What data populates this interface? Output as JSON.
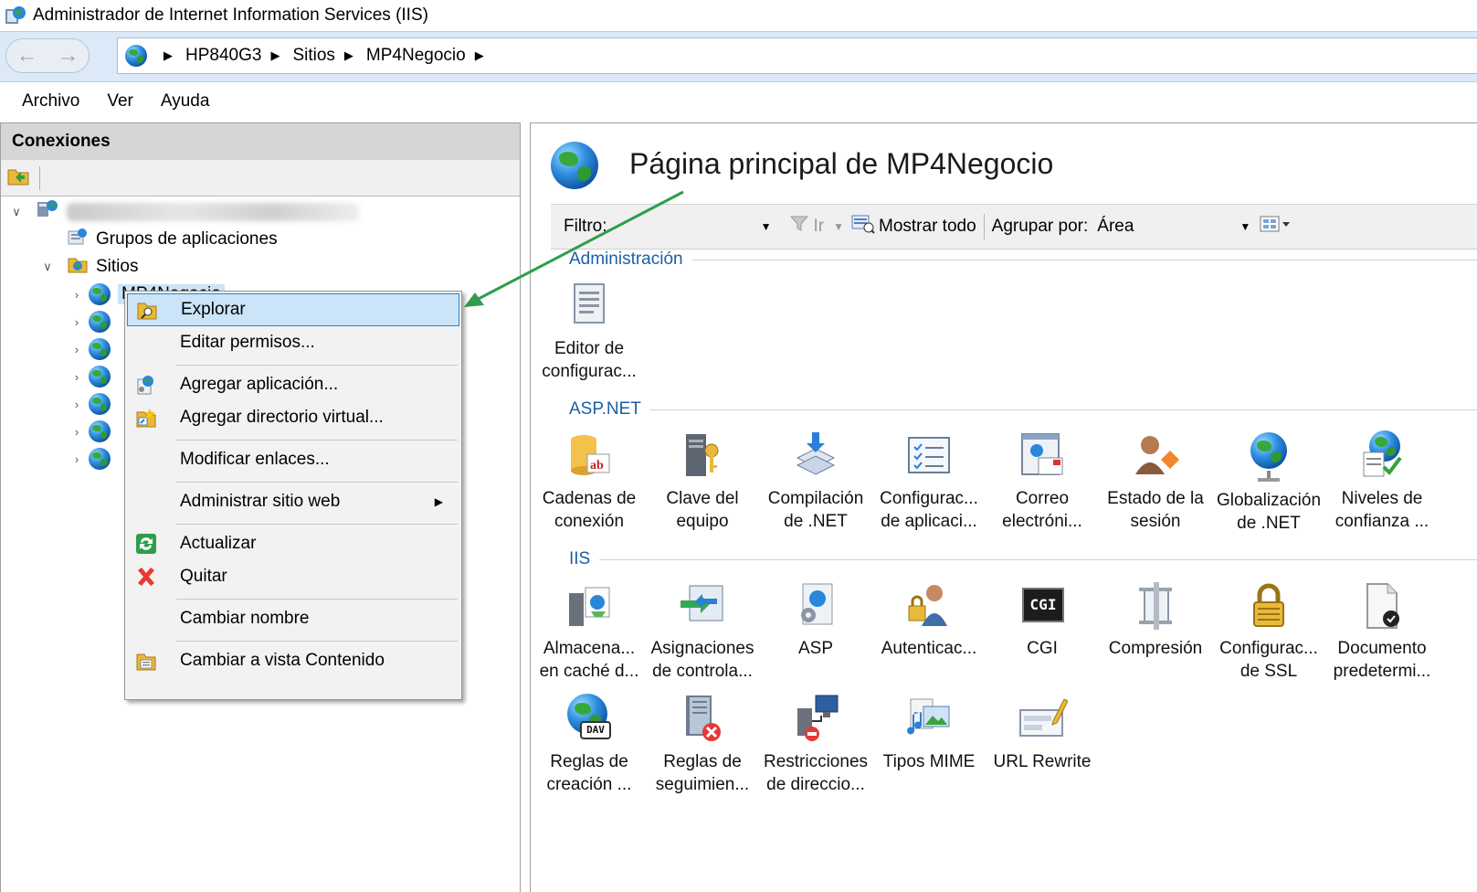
{
  "window": {
    "title": "Administrador de Internet Information Services (IIS)"
  },
  "address": {
    "crumbs": [
      "HP840G3",
      "Sitios",
      "MP4Negocio"
    ]
  },
  "menu": [
    "Archivo",
    "Ver",
    "Ayuda"
  ],
  "connections": {
    "header": "Conexiones",
    "tree": {
      "app_pools": "Grupos de aplicaciones",
      "sites": "Sitios",
      "selected_site": "MP4Negocio"
    }
  },
  "context_menu": {
    "items": [
      "Explorar",
      "Editar permisos...",
      "Agregar aplicación...",
      "Agregar directorio virtual...",
      "Modificar enlaces...",
      "Administrar sitio web",
      "Actualizar",
      "Quitar",
      "Cambiar nombre",
      "Cambiar a vista Contenido"
    ]
  },
  "main": {
    "title": "Página principal de MP4Negocio",
    "filter": {
      "label": "Filtro:",
      "go": "Ir",
      "show_all": "Mostrar todo",
      "group_by_label": "Agrupar por:",
      "group_by_value": "Área"
    },
    "sections": {
      "admin": "Administración",
      "aspnet": "ASP.NET",
      "iis": "IIS"
    },
    "admin_features": [
      {
        "l1": "Editor de",
        "l2": "configurac...",
        "icon": "config-editor-icon"
      }
    ],
    "aspnet_features": [
      {
        "l1": "Cadenas de",
        "l2": "conexión",
        "icon": "connection-strings-icon"
      },
      {
        "l1": "Clave del",
        "l2": "equipo",
        "icon": "machine-key-icon"
      },
      {
        "l1": "Compilación",
        "l2": "de .NET",
        "icon": "net-compilation-icon"
      },
      {
        "l1": "Configurac...",
        "l2": "de aplicaci...",
        "icon": "app-settings-icon"
      },
      {
        "l1": "Correo",
        "l2": "electróni...",
        "icon": "smtp-email-icon"
      },
      {
        "l1": "Estado de la",
        "l2": "sesión",
        "icon": "session-state-icon"
      },
      {
        "l1": "Globalización",
        "l2": "de .NET",
        "icon": "net-globalization-icon"
      },
      {
        "l1": "Niveles de",
        "l2": "confianza ...",
        "icon": "trust-levels-icon"
      }
    ],
    "iis_features": [
      {
        "l1": "Almacena...",
        "l2": "en caché d...",
        "icon": "output-caching-icon"
      },
      {
        "l1": "Asignaciones",
        "l2": "de controla...",
        "icon": "handler-mappings-icon"
      },
      {
        "l1": "ASP",
        "l2": "",
        "icon": "asp-icon"
      },
      {
        "l1": "Autenticac...",
        "l2": "",
        "icon": "authentication-icon"
      },
      {
        "l1": "CGI",
        "l2": "",
        "icon": "cgi-icon"
      },
      {
        "l1": "Compresión",
        "l2": "",
        "icon": "compression-icon"
      },
      {
        "l1": "Configurac...",
        "l2": "de SSL",
        "icon": "ssl-settings-icon"
      },
      {
        "l1": "Documento",
        "l2": "predetermi...",
        "icon": "default-document-icon"
      },
      {
        "l1": "Reglas de",
        "l2": "creación ...",
        "icon": "webdav-authoring-icon"
      },
      {
        "l1": "Reglas de",
        "l2": "seguimien...",
        "icon": "failed-request-tracing-icon"
      },
      {
        "l1": "Restricciones",
        "l2": "de direccio...",
        "icon": "ip-restrictions-icon"
      },
      {
        "l1": "Tipos MIME",
        "l2": "",
        "icon": "mime-types-icon"
      },
      {
        "l1": "URL Rewrite",
        "l2": "",
        "icon": "url-rewrite-icon"
      }
    ],
    "cgi_badge": "CGI",
    "dav_badge": "DAV"
  },
  "colors": {
    "accent": "#1c5fa8",
    "selection": "#cce4f7",
    "selection_border": "#2f83cf",
    "annotation_arrow": "#2e9e4a",
    "remove_x": "#e53935"
  }
}
